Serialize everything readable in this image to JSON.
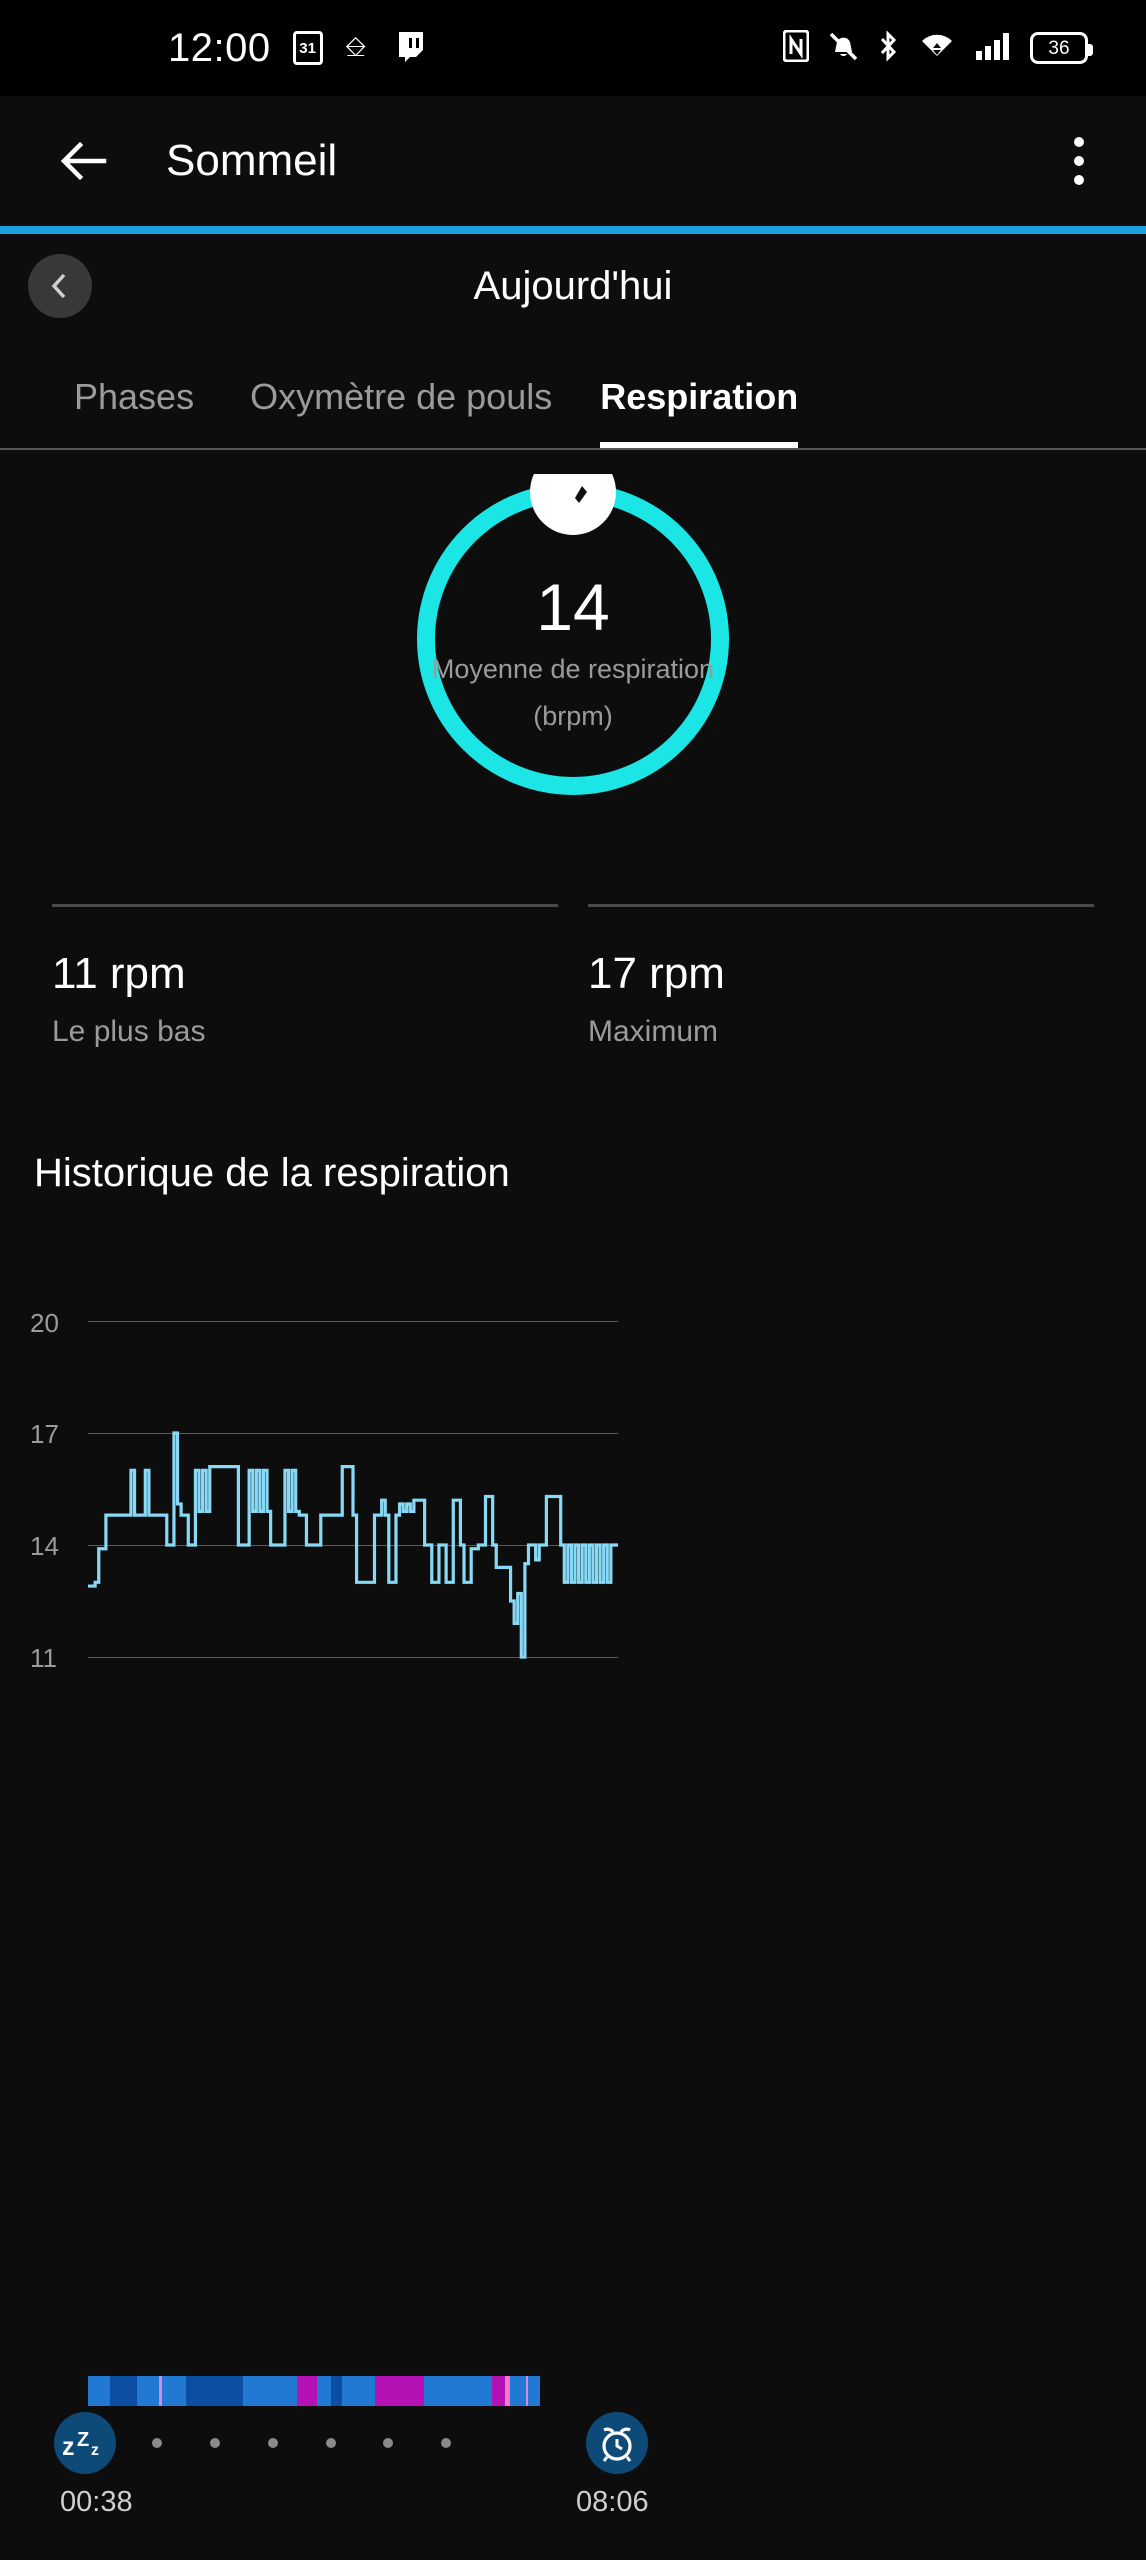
{
  "statusbar": {
    "time": "12:00",
    "calendar_day": "31",
    "left_icons": [
      "calendar-icon",
      "mastodon-icon",
      "twitch-icon"
    ],
    "right_icons": [
      "nfc-icon",
      "mute-icon",
      "bluetooth-icon",
      "wifi-icon",
      "cellular-icon"
    ],
    "battery_level": "36"
  },
  "appbar": {
    "back_label": "back-arrow",
    "title": "Sommeil",
    "overflow_label": "more-options"
  },
  "datenav": {
    "prev_label": "‹",
    "date": "Aujourd'hui"
  },
  "tabs": [
    {
      "label": "Phases",
      "active": false
    },
    {
      "label": "Oxymètre de pouls",
      "active": false
    },
    {
      "label": "Respiration",
      "active": true
    }
  ],
  "gauge": {
    "value": "14",
    "label_line1": "Moyenne de respiration",
    "label_line2": "(brpm)",
    "ring_color": "#1ce5e5",
    "knob_color": "#ffffff",
    "progress_pct": 100
  },
  "stats": [
    {
      "value": "11 rpm",
      "caption": "Le plus bas"
    },
    {
      "value": "17 rpm",
      "caption": "Maximum"
    }
  ],
  "history": {
    "title": "Historique de la respiration"
  },
  "timeline": {
    "start_time": "00:38",
    "end_time": "08:06",
    "start_icon": "sleep-zzz-icon",
    "end_icon": "alarm-clock-icon",
    "tick_count": 6
  },
  "phases": {
    "legend_colors": {
      "light": "#2279d4",
      "deep": "#0b4ea2",
      "rem": "#b412b4",
      "awake": "#ef7ac8"
    },
    "segments": [
      {
        "color": "#2279d4",
        "width": 4.2
      },
      {
        "color": "#0b4ea2",
        "width": 5.0
      },
      {
        "color": "#2279d4",
        "width": 4.2
      },
      {
        "color": "#d08ae0",
        "width": 0.5
      },
      {
        "color": "#2279d4",
        "width": 4.6
      },
      {
        "color": "#0b4ea2",
        "width": 10.8
      },
      {
        "color": "#2279d4",
        "width": 10.2
      },
      {
        "color": "#b412b4",
        "width": 3.8
      },
      {
        "color": "#2279d4",
        "width": 2.6
      },
      {
        "color": "#0b4ea2",
        "width": 2.0
      },
      {
        "color": "#2279d4",
        "width": 6.2
      },
      {
        "color": "#b412b4",
        "width": 9.4
      },
      {
        "color": "#2279d4",
        "width": 12.8
      },
      {
        "color": "#b412b4",
        "width": 2.4
      },
      {
        "color": "#ef7ac8",
        "width": 0.9
      },
      {
        "color": "#2279d4",
        "width": 3.0
      },
      {
        "color": "#d08ae0",
        "width": 0.5
      },
      {
        "color": "#2279d4",
        "width": 2.2
      }
    ]
  },
  "chart_data": {
    "type": "line",
    "title": "Historique de la respiration",
    "xlabel": "",
    "ylabel": "brpm",
    "ylim": [
      9.5,
      20.8
    ],
    "yticks": [
      11,
      14,
      17,
      20
    ],
    "grid": true,
    "line_color": "#87d9f5",
    "x_start_label": "00:38",
    "x_end_label": "08:06",
    "values": [
      12.9,
      12.9,
      13.0,
      13.9,
      13.9,
      14.8,
      14.8,
      14.8,
      14.8,
      14.8,
      14.8,
      14.8,
      16.0,
      14.8,
      14.8,
      14.8,
      16.0,
      14.8,
      14.8,
      14.8,
      14.8,
      14.8,
      14.0,
      14.0,
      17.0,
      15.1,
      14.8,
      14.8,
      14.0,
      14.0,
      16.0,
      14.9,
      16.0,
      14.9,
      16.1,
      16.1,
      16.1,
      16.1,
      16.1,
      16.1,
      16.1,
      16.1,
      14.0,
      14.0,
      14.0,
      16.0,
      14.9,
      16.0,
      14.9,
      16.0,
      14.9,
      14.0,
      14.0,
      14.0,
      14.0,
      16.0,
      14.9,
      16.0,
      14.9,
      14.8,
      14.8,
      14.0,
      14.0,
      14.0,
      14.0,
      14.8,
      14.8,
      14.8,
      14.8,
      14.8,
      14.8,
      16.1,
      16.1,
      16.1,
      14.8,
      13.0,
      13.0,
      13.0,
      13.0,
      13.0,
      14.8,
      14.8,
      15.2,
      14.8,
      13.0,
      13.0,
      14.8,
      15.1,
      14.9,
      15.1,
      14.9,
      15.2,
      15.2,
      15.2,
      14.0,
      14.0,
      13.0,
      13.0,
      14.0,
      14.0,
      13.0,
      13.0,
      15.2,
      15.2,
      14.0,
      13.0,
      13.0,
      13.9,
      13.9,
      14.0,
      14.0,
      15.3,
      15.3,
      14.0,
      13.4,
      13.4,
      13.4,
      13.4,
      12.5,
      11.9,
      12.7,
      11.0,
      13.5,
      14.0,
      14.0,
      13.6,
      14.0,
      14.0,
      15.3,
      15.3,
      15.3,
      15.3,
      14.0,
      13.0,
      14.0,
      13.0,
      14.0,
      13.0,
      14.0,
      13.0,
      14.0,
      13.0,
      14.0,
      13.0,
      14.0,
      13.0,
      14.0,
      14.0
    ]
  }
}
